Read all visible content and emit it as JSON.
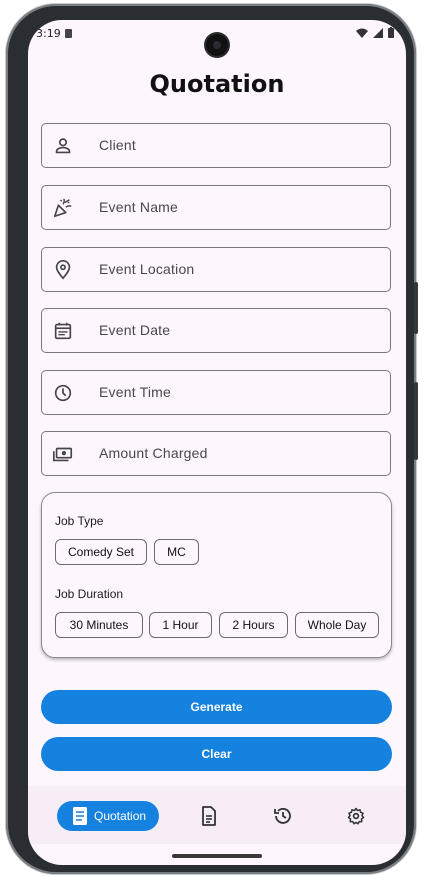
{
  "status_bar": {
    "time": "3:19"
  },
  "page": {
    "title": "Quotation"
  },
  "form": {
    "fields": [
      {
        "placeholder": "Client",
        "icon": "person-icon"
      },
      {
        "placeholder": "Event Name",
        "icon": "party-popper-icon"
      },
      {
        "placeholder": "Event Location",
        "icon": "location-pin-icon"
      },
      {
        "placeholder": "Event Date",
        "icon": "calendar-icon"
      },
      {
        "placeholder": "Event Time",
        "icon": "clock-icon"
      },
      {
        "placeholder": "Amount Charged",
        "icon": "money-icon"
      }
    ]
  },
  "options": {
    "job_type_label": "Job Type",
    "job_types": [
      "Comedy Set",
      "MC"
    ],
    "job_duration_label": "Job Duration",
    "job_durations": [
      "30 Minutes",
      "1 Hour",
      "2 Hours",
      "Whole Day"
    ]
  },
  "actions": {
    "generate_label": "Generate",
    "clear_label": "Clear"
  },
  "bottom_nav": {
    "active_label": "Quotation",
    "items": [
      "quotation-icon",
      "document-icon",
      "history-icon",
      "settings-icon"
    ]
  },
  "colors": {
    "accent": "#1682e0",
    "background": "#fdf6fd",
    "nav_background": "#f6edf6"
  }
}
